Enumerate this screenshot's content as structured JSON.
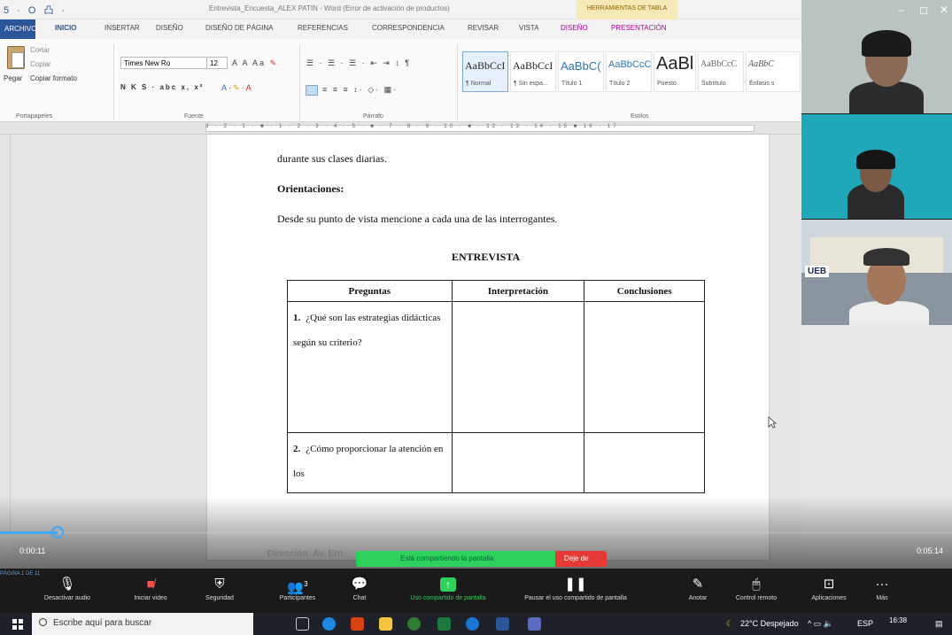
{
  "word": {
    "title": "Entrevista_Encuesta_ALEX PATIN - Word (Error de activación de productos)",
    "tool_title": "HERRAMIENTAS DE TABLA",
    "quick_access": "5 · O 凸 ·",
    "tabs": [
      "ARCHIVO",
      "INICIO",
      "INSERTAR",
      "DISEÑO",
      "DISEÑO DE PÁGINA",
      "REFERENCIAS",
      "CORRESPONDENCIA",
      "REVISAR",
      "VISTA",
      "DISEÑO",
      "PRESENTACIÓN"
    ],
    "clipboard": {
      "paste": "Pegar",
      "cut": "Cortar",
      "copy": "Copiar",
      "format": "Copiar formato",
      "group": "Portapapeles"
    },
    "font": {
      "name": "Times New Ro",
      "size": "12",
      "bold_row": "N K S · abc x, x²",
      "group": "Fuente"
    },
    "paragraph": {
      "group": "Párrafo"
    },
    "styles": {
      "group": "Estilos",
      "items": [
        {
          "sample": "AaBbCcI",
          "name": "¶ Normal"
        },
        {
          "sample": "AaBbCcI",
          "name": "¶ Sin espa..."
        },
        {
          "sample": "AaBbC(",
          "name": "Título 1"
        },
        {
          "sample": "AaBbCcC",
          "name": "Título 2"
        },
        {
          "sample": "AaBl",
          "name": "Puesto"
        },
        {
          "sample": "AaBbCcC",
          "name": "Subtítulo"
        },
        {
          "sample": "AaBbC",
          "name": "Énfasis s"
        }
      ]
    },
    "ruler_numbers": "3 · 2 · 1 · ■ · 1 · 2 · 3 · 4 · 5 · ■ · 7 · 8 · 9 · 10 · ■ · 12 · 13 · 14 · 15 ■ 16 · 17"
  },
  "document": {
    "line1": "durante sus clases diarias.",
    "orientaciones": "Orientaciones:",
    "instruction": "Desde su punto de vista mencione a cada una de las interrogantes.",
    "heading": "ENTREVISTA",
    "table": {
      "headers": [
        "Preguntas",
        "Interpretación",
        "Conclusiones"
      ],
      "rows": [
        {
          "num": "1.",
          "text": "¿Qué son las estrategias didácticas según su criterio?"
        },
        {
          "num": "2.",
          "text": "¿Cómo proporcionar la atención en los"
        }
      ]
    },
    "footer_fragment": "Dirección: Av. Ern"
  },
  "zoom": {
    "elapsed": "0:00:11",
    "total": "0:05:14",
    "progress": 0.06,
    "share_status": "Está compartiendo la pantalla",
    "stop_share": "Deje de",
    "status_page": "PÁGINA 1 DE 11",
    "participants_count": "3",
    "toolbar": [
      {
        "icon": "audio-icon",
        "label": "Desactivar audio"
      },
      {
        "icon": "video-off-icon",
        "label": "Iniciar video"
      },
      {
        "icon": "shield-icon",
        "label": "Seguridad"
      },
      {
        "icon": "participants-icon",
        "label": "Participantes"
      },
      {
        "icon": "chat-icon",
        "label": "Chat"
      },
      {
        "icon": "share-icon",
        "label": "Uso compartido de pantalla"
      },
      {
        "icon": "pause-icon",
        "label": "Pausar el uso compartido de pantalla"
      },
      {
        "icon": "annotate-icon",
        "label": "Anotar"
      },
      {
        "icon": "remote-control-icon",
        "label": "Control remoto"
      },
      {
        "icon": "apps-icon",
        "label": "Aplicaciones"
      },
      {
        "icon": "more-icon",
        "label": "Más"
      }
    ]
  },
  "videos": {
    "logo_text": "UEB"
  },
  "taskbar": {
    "search_placeholder": "Escribe aquí para buscar",
    "weather": "22°C Despejado",
    "lang": "ESP",
    "time": "16:38"
  },
  "colors": {
    "word_blue": "#2b579a",
    "zoom_green": "#2ed15b",
    "zoom_red": "#e53935"
  }
}
